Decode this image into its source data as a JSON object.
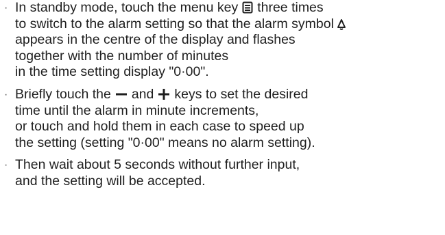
{
  "bullet_symbol": "·",
  "instructions": [
    {
      "lines": [
        {
          "before": "In standby mode, touch the menu key",
          "icon": "menu-key-icon",
          "after": "three times"
        },
        {
          "before": "to switch to the alarm setting so that the alarm symbol",
          "icon": "alarm-bell-icon",
          "after": ""
        },
        {
          "text": "appears in the centre of the display and flashes"
        },
        {
          "text": "together with the number of minutes"
        },
        {
          "text": "in the time setting display \"0·00\"."
        }
      ]
    },
    {
      "lines": [
        {
          "before": "Briefly touch the",
          "icon": "minus-key-icon",
          "middle": "and",
          "icon2": "plus-key-icon",
          "after": "keys to set the desired"
        },
        {
          "text": "time until the alarm in minute increments,"
        },
        {
          "text": "or touch and hold them in each case to speed up"
        },
        {
          "text": "the setting (setting \"0·00\" means no alarm setting)."
        }
      ]
    },
    {
      "lines": [
        {
          "text": "Then wait about 5 seconds without further input,"
        },
        {
          "text": "and the setting will be accepted."
        }
      ]
    }
  ]
}
